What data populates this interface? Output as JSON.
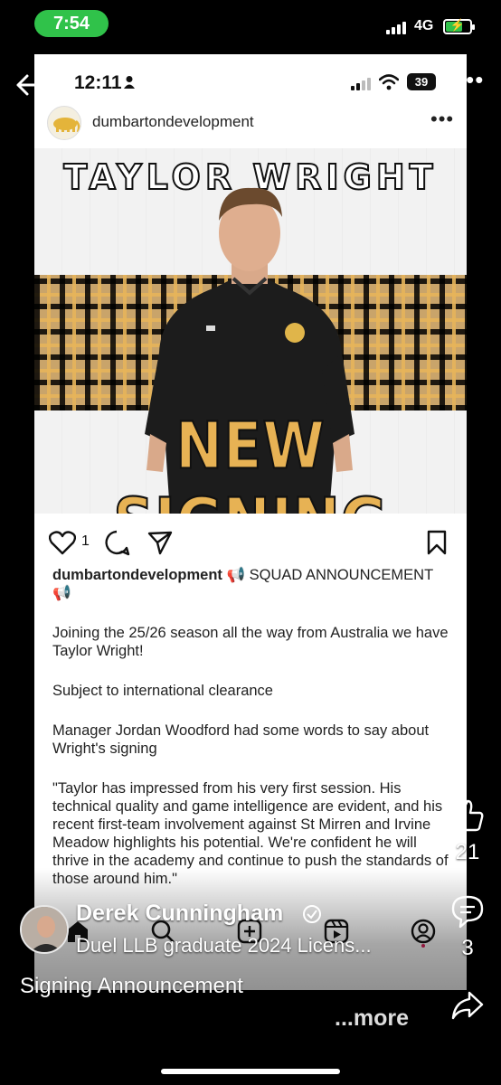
{
  "outer_status": {
    "time": "7:54",
    "network": "4G",
    "battery_charging": true
  },
  "inner_status": {
    "time": "12:11",
    "battery": "39"
  },
  "account": {
    "name": "dumbartondevelopment"
  },
  "post_image": {
    "headline": "TAYLOR WRIGHT",
    "banner": "NEW SIGNING"
  },
  "actions": {
    "like_count": "1"
  },
  "caption": {
    "user": "dumbartondevelopment",
    "title": " 📢 SQUAD ANNOUNCEMENT 📢",
    "p1": "Joining the 25/26 season all the way from Australia we have Taylor Wright!",
    "p2": "Subject to international clearance",
    "p3": "Manager Jordan Woodford had some words to say about Wright's signing",
    "p4": "\"Taylor has impressed from his very first session. His technical quality and game intelligence are evident, and his recent first-team involvement against St Mirren and Irvine Meadow highlights his potential. We're confident he will thrive in the academy and continue to push the standards of those around him.\""
  },
  "overlay": {
    "author_name": "Derek Cunningham",
    "author_headline": "Duel LLB graduate 2024 Licens...",
    "post_title": "Signing Announcement",
    "more_label": "...more",
    "likes": "21",
    "comments": "3"
  },
  "colors": {
    "pill_green": "#30c24a",
    "banner_gold": "#e7b254"
  },
  "icons": [
    "back-arrow-icon",
    "more-icon",
    "heart-icon",
    "comment-icon",
    "share-icon",
    "bookmark-icon",
    "home-icon",
    "search-icon",
    "create-icon",
    "reels-icon",
    "profile-icon",
    "thumbs-up-icon",
    "verified-icon"
  ]
}
